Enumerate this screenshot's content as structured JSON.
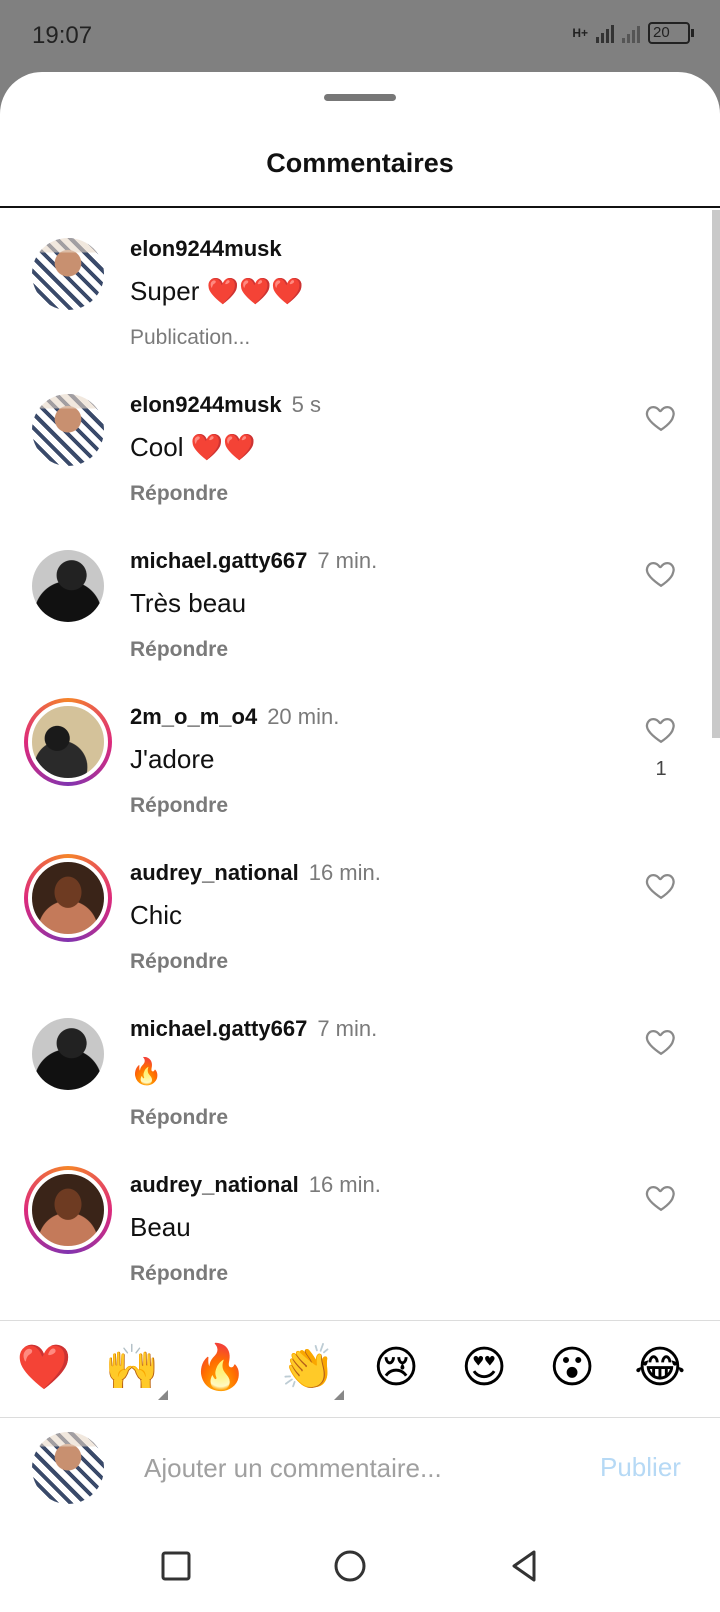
{
  "status_bar": {
    "time": "19:07",
    "network": "H+",
    "battery": "20"
  },
  "sheet": {
    "title": "Commentaires"
  },
  "comments": [
    {
      "username": "elon9244musk",
      "time": "",
      "text": "Super ❤️❤️❤️",
      "action": "Publication...",
      "avatar": "elon-avatar",
      "likes": "",
      "pending": true
    },
    {
      "username": "elon9244musk",
      "time": "5 s",
      "text": "Cool ❤️❤️",
      "action": "Répondre",
      "avatar": "elon-avatar",
      "likes": ""
    },
    {
      "username": "michael.gatty667",
      "time": "7 min.",
      "text": "Très beau",
      "action": "Répondre",
      "avatar": "michael-avatar",
      "likes": ""
    },
    {
      "username": "2m_o_m_o4",
      "time": "20 min.",
      "text": "J'adore",
      "action": "Répondre",
      "avatar": "2m-avatar",
      "likes": "1",
      "story_ring": true
    },
    {
      "username": "audrey_national",
      "time": "16 min.",
      "text": "Chic",
      "action": "Répondre",
      "avatar": "audrey-avatar",
      "likes": "",
      "story_ring": true
    },
    {
      "username": "michael.gatty667",
      "time": "7 min.",
      "text": "🔥",
      "action": "Répondre",
      "avatar": "michael-avatar",
      "likes": ""
    },
    {
      "username": "audrey_national",
      "time": "16 min.",
      "text": "Beau",
      "action": "Répondre",
      "avatar": "audrey-avatar",
      "likes": "",
      "story_ring": true
    }
  ],
  "emoji_bar": [
    "❤️",
    "🙌",
    "🔥",
    "👏",
    "😢",
    "😍",
    "😮",
    "😂"
  ],
  "composer": {
    "placeholder": "Ajouter un commentaire...",
    "publish_label": "Publier"
  },
  "nav_icons": [
    "recents-square-icon",
    "home-circle-icon",
    "back-triangle-icon"
  ],
  "colors": {
    "publish_disabled": "#b6d9f5",
    "story_ring": "#dd2a7b"
  }
}
